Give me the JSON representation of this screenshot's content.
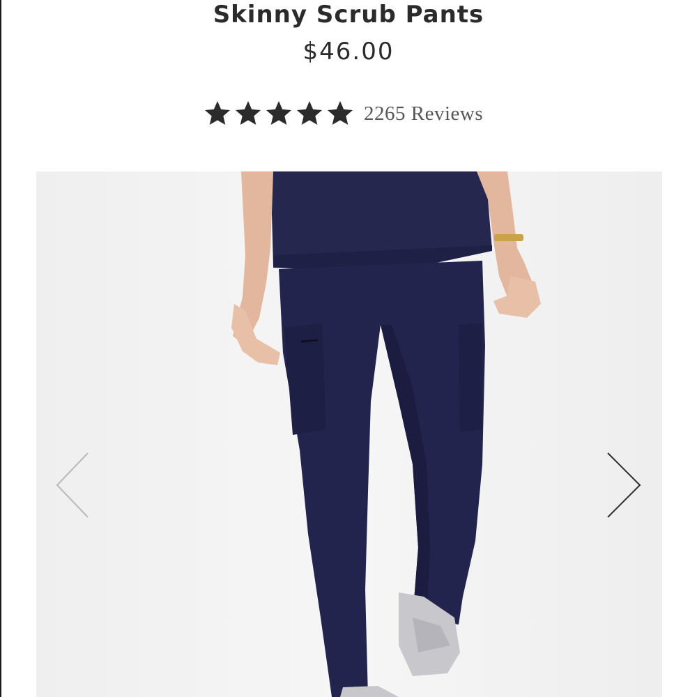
{
  "product": {
    "title": "Skinny Scrub Pants",
    "price": "$46.00"
  },
  "rating": {
    "stars": 5,
    "max_stars": 5,
    "reviews_text": "2265 Reviews"
  },
  "gallery": {
    "prev_icon": "chevron-left-icon",
    "next_icon": "chevron-right-icon"
  },
  "colors": {
    "text": "#2b2b2b",
    "star": "#2b2b2b",
    "scrubs_navy": "#23244d",
    "background": "#f3f3f3"
  }
}
